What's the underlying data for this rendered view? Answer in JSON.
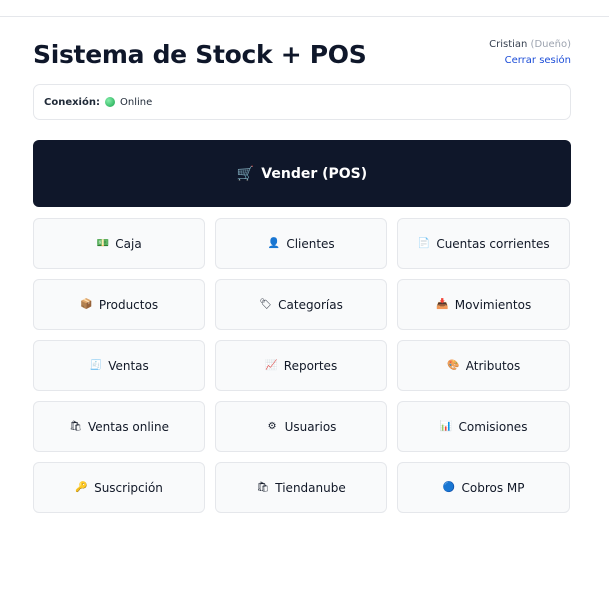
{
  "header": {
    "title": "Sistema de Stock + POS",
    "user_name": "Cristian",
    "user_role": "(Dueño)",
    "logout_label": "Cerrar sesión"
  },
  "connection": {
    "label": "Conexión:",
    "status": "Online",
    "status_color": "#22c55e"
  },
  "sell_button": {
    "icon": "cart-icon",
    "label": "Vender (POS)"
  },
  "menu": [
    {
      "icon": "cash-icon",
      "label": "Caja"
    },
    {
      "icon": "user-icon",
      "label": "Clientes"
    },
    {
      "icon": "document-icon",
      "label": "Cuentas corrientes"
    },
    {
      "icon": "package-icon",
      "label": "Productos"
    },
    {
      "icon": "tag-icon",
      "label": "Categorías"
    },
    {
      "icon": "inbox-tray-icon",
      "label": "Movimientos"
    },
    {
      "icon": "receipt-icon",
      "label": "Ventas"
    },
    {
      "icon": "chart-up-icon",
      "label": "Reportes"
    },
    {
      "icon": "palette-icon",
      "label": "Atributos"
    },
    {
      "icon": "shopping-bags-icon",
      "label": "Ventas online"
    },
    {
      "icon": "gear-icon",
      "label": "Usuarios"
    },
    {
      "icon": "bar-chart-icon",
      "label": "Comisiones"
    },
    {
      "icon": "key-icon",
      "label": "Suscripción"
    },
    {
      "icon": "shopping-bags-icon",
      "label": "Tiendanube"
    },
    {
      "icon": "blue-circle-icon",
      "label": "Cobros MP"
    }
  ]
}
